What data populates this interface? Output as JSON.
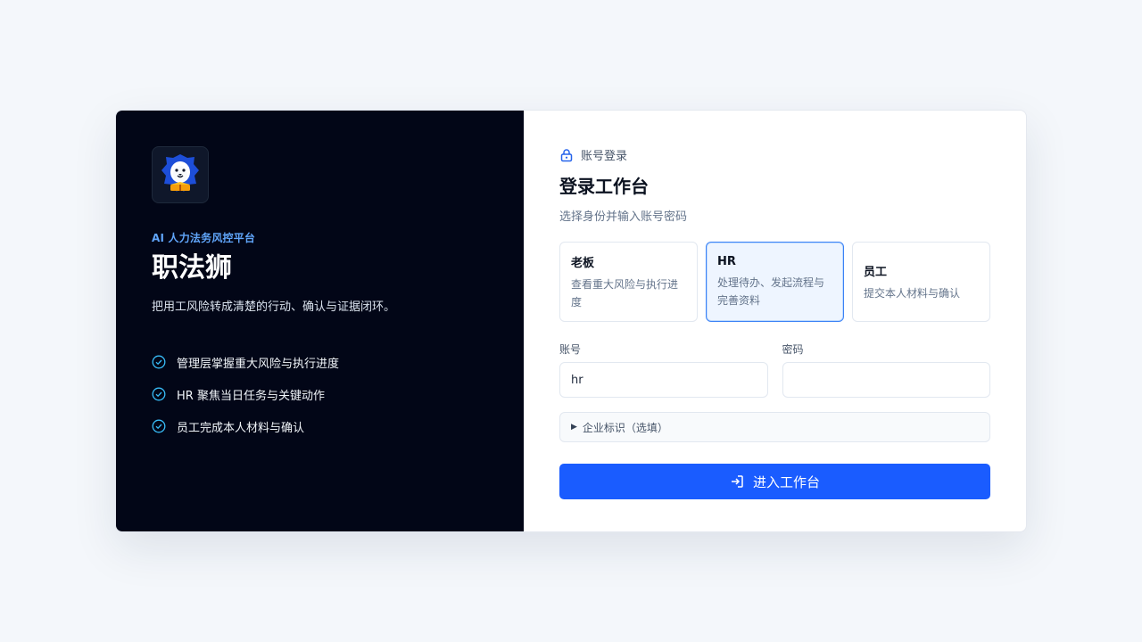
{
  "brand": {
    "logo_icon": "lion-icon",
    "subtitle": "AI 人力法务风控平台",
    "name": "职法狮",
    "slogan": "把用工风险转成清楚的行动、确认与证据闭环。",
    "features": [
      "管理层掌握重大风险与执行进度",
      "HR 聚焦当日任务与关键动作",
      "员工完成本人材料与确认"
    ]
  },
  "login": {
    "mode_label": "账号登录",
    "mode_icon": "lock-icon",
    "title": "登录工作台",
    "description": "选择身份并输入账号密码",
    "roles": [
      {
        "name": "老板",
        "desc": "查看重大风险与执行进度",
        "active": false
      },
      {
        "name": "HR",
        "desc": "处理待办、发起流程与完善资料",
        "active": true
      },
      {
        "name": "员工",
        "desc": "提交本人材料与确认",
        "active": false
      }
    ],
    "account_label": "账号",
    "account_value": "hr",
    "password_label": "密码",
    "password_value": "",
    "company_toggle": "企业标识（选填）",
    "submit_label": "进入工作台"
  },
  "colors": {
    "accent": "#1a5cff",
    "left_bg": "#020617",
    "subtitle": "#60a5fa",
    "check": "#38bdf8"
  }
}
